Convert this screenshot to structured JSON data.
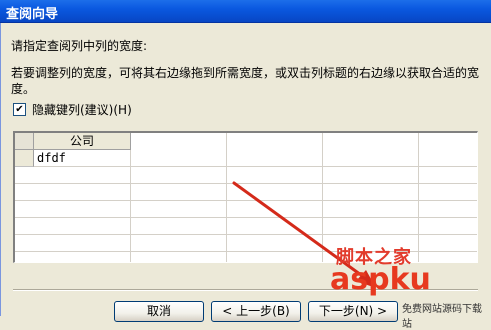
{
  "window": {
    "title": "查阅向导"
  },
  "instructions": {
    "line1": "请指定查阅列中列的宽度:",
    "line2": "若要调整列的宽度，可将其右边缘拖到所需宽度，或双击列标题的右边缘以获取合适的宽度。"
  },
  "hide_key_column": {
    "label": "隐藏键列(建议)(H)",
    "checked": true
  },
  "grid": {
    "column_header": "公司",
    "rows": [
      {
        "value": "dfdf"
      }
    ]
  },
  "buttons": {
    "cancel": "取消",
    "back": "< 上一步(B)",
    "next": "下一步(N) >"
  },
  "watermark": {
    "line1": "脚本之家",
    "line2": "aspku",
    "line3": "免费网站源码下载站"
  }
}
